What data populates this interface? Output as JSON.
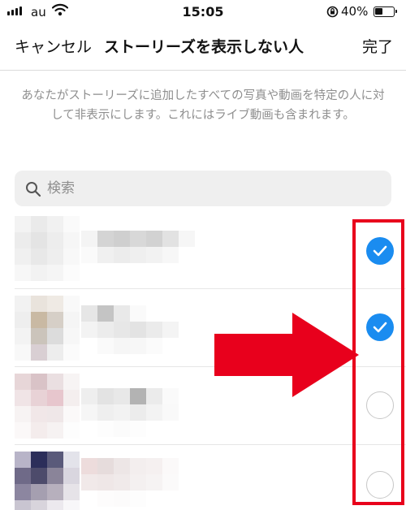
{
  "status_bar": {
    "carrier": "au",
    "time": "15:05",
    "battery_percent": "40%",
    "battery_level": 0.4
  },
  "nav": {
    "cancel_label": "キャンセル",
    "title": "ストーリーズを表示しない人",
    "done_label": "完了"
  },
  "description": "あなたがストーリーズに追加したすべての写真や動画を特定の人に対して非表示にします。これにはライブ動画も含まれます。",
  "search": {
    "placeholder": "検索"
  },
  "rows": [
    {
      "checked": true,
      "icon": "checkmark-icon"
    },
    {
      "checked": true,
      "icon": "checkmark-icon"
    },
    {
      "checked": false,
      "icon": "empty-circle"
    },
    {
      "checked": false,
      "icon": "empty-circle"
    }
  ],
  "colors": {
    "accent_blue": "#1a8cf0",
    "annotation_red": "#e8001c",
    "secondary_text": "#8e8e8e"
  }
}
